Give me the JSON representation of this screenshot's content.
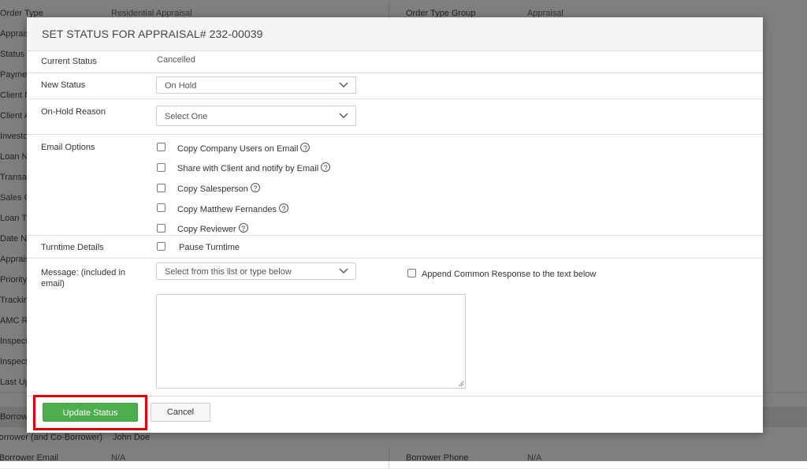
{
  "background": {
    "rows": [
      {
        "label": "Order Type",
        "value": "Residential Appraisal",
        "label2": "Order Type Group",
        "value2": "Appraisal"
      },
      {
        "label": "Appraisal"
      },
      {
        "label": "Status"
      },
      {
        "label": "Payment"
      },
      {
        "label": "Client Name"
      },
      {
        "label": "Client Address"
      },
      {
        "label": "Investor N"
      },
      {
        "label": "Loan Num"
      },
      {
        "label": "Transaction"
      },
      {
        "label": "Sales Con"
      },
      {
        "label": "Loan Type"
      },
      {
        "label": "Date Need"
      },
      {
        "label": "Appraiser"
      },
      {
        "label": "Priority"
      },
      {
        "label": "Tracking I"
      },
      {
        "label": "AMC Reg"
      },
      {
        "label": "Inspection"
      },
      {
        "label": "Inspection"
      },
      {
        "label": "Last Upda"
      },
      {
        "label": "Borrower",
        "section": true
      },
      {
        "label": "Borrower (and Co-Borrower)",
        "value": "John Doe"
      },
      {
        "label": "Borrower Email",
        "value": "N/A",
        "label2": "Borrower Phone",
        "value2": "N/A"
      }
    ]
  },
  "modal": {
    "title": "SET STATUS FOR APPRAISAL# 232-00039",
    "current_status": {
      "label": "Current Status",
      "value": "Cancelled"
    },
    "new_status": {
      "label": "New Status",
      "selected": "On Hold"
    },
    "on_hold_reason": {
      "label": "On-Hold Reason",
      "selected": "Select One"
    },
    "email_options": {
      "label": "Email Options",
      "items": [
        {
          "label": "Copy Company Users on Email",
          "help": "?"
        },
        {
          "label": "Share with Client and notify by Email",
          "help": "?"
        },
        {
          "label": "Copy Salesperson",
          "help": "?"
        },
        {
          "label": "Copy Matthew Fernandes",
          "help": "?"
        },
        {
          "label": "Copy Reviewer",
          "help": "?"
        }
      ]
    },
    "turntime": {
      "label": "Turntime Details",
      "checkbox_label": "Pause Turntime"
    },
    "message": {
      "label": "Message: (included in email)",
      "select_placeholder": "Select from this list or type below",
      "append_label": "Append Common Response to the text below",
      "text": ""
    },
    "buttons": {
      "update": "Update Status",
      "cancel": "Cancel"
    }
  },
  "colors": {
    "primary_button": "#4cae4c",
    "highlight": "#e00000"
  }
}
